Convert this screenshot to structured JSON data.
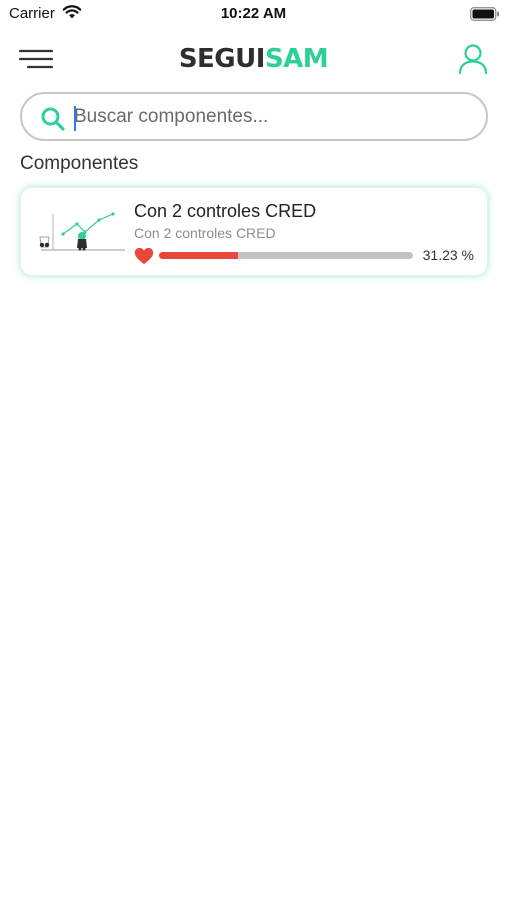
{
  "status_bar": {
    "carrier": "Carrier",
    "time": "10:22 AM",
    "icons": [
      "wifi-icon",
      "battery-icon"
    ]
  },
  "header": {
    "menu_icon": "hamburger-menu-icon",
    "logo_part1": "SEGUI",
    "logo_part2": "SAM",
    "profile_icon": "user-profile-icon"
  },
  "search": {
    "placeholder": "Buscar componentes...",
    "value": "",
    "icon": "search-icon"
  },
  "section": {
    "title": "Componentes"
  },
  "components": [
    {
      "title": "Con 2 controles CRED",
      "subtitle": "Con 2 controles CRED",
      "progress_label": "31.23 %",
      "progress_fraction": 0.3123,
      "icon": "heart-icon",
      "thumbnail": "growth-chart-illustration"
    }
  ],
  "colors": {
    "brand_dark": "#2e2e2e",
    "brand_accent": "#2fcf9c",
    "progress_fill": "#e9473a",
    "progress_track": "#c3c3c3",
    "heart": "#e9473a"
  }
}
